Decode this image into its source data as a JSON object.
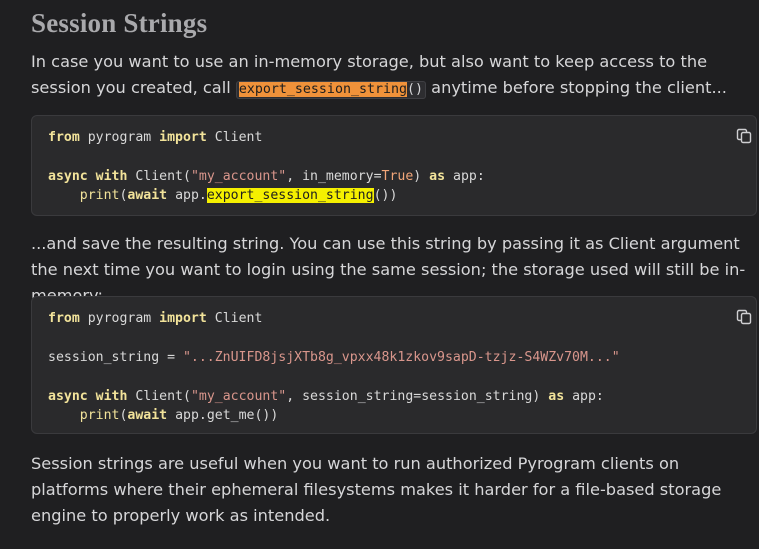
{
  "section": {
    "title": "Session Strings"
  },
  "intro": {
    "text_before": "In case you want to use an in-memory storage, but also want to keep access to the session you created, call ",
    "inline_code_name": "export_session_string",
    "inline_code_parens": "()",
    "text_after": " anytime before stopping the client..."
  },
  "code1": {
    "line1": {
      "kw_from": "from",
      "module": " pyrogram ",
      "kw_import": "import",
      "name": " Client"
    },
    "line2": {
      "kw_async": "async",
      "sp1": " ",
      "kw_with": "with",
      "call_start": " Client(",
      "str_arg": "\"my_account\"",
      "mid": ", in_memory=",
      "kw_true": "True",
      "close": ") ",
      "kw_as": "as",
      "tail": " app:"
    },
    "line3": {
      "indent": "    ",
      "fn_print": "print",
      "open": "(",
      "kw_await": "await",
      "obj": " app.",
      "method_highlight": "export_session_string",
      "tail": "())"
    }
  },
  "middle": {
    "text": "...and save the resulting string. You can use this string by passing it as Client argument the next time you want to login using the same session; the storage used will still be in-memory:"
  },
  "code2": {
    "line1": {
      "kw_from": "from",
      "module": " pyrogram ",
      "kw_import": "import",
      "name": " Client"
    },
    "line2": {
      "var": "session_string = ",
      "str_val": "\"...ZnUIFD8jsjXTb8g_vpxx48k1zkov9sapD-tzjz-S4WZv70M...\""
    },
    "line3": {
      "kw_async": "async",
      "sp1": " ",
      "kw_with": "with",
      "call_start": " Client(",
      "str_arg": "\"my_account\"",
      "mid": ", session_string=session_string) ",
      "kw_as": "as",
      "tail": " app:"
    },
    "line4": {
      "indent": "    ",
      "fn_print": "print",
      "open": "(",
      "kw_await": "await",
      "tail": " app.get_me())"
    }
  },
  "outro": {
    "text": "Session strings are useful when you want to run authorized Pyrogram clients on platforms where their ephemeral filesystems makes it harder for a file-based storage engine to properly work as intended."
  },
  "icons": {
    "copy": "copy-icon"
  },
  "colors": {
    "background": "#1f1f21",
    "code_background": "#2a2a2c",
    "keyword": "#f2e39a",
    "string": "#d9968c",
    "highlight_orange": "#f0923a",
    "highlight_yellow": "#f5f000"
  }
}
